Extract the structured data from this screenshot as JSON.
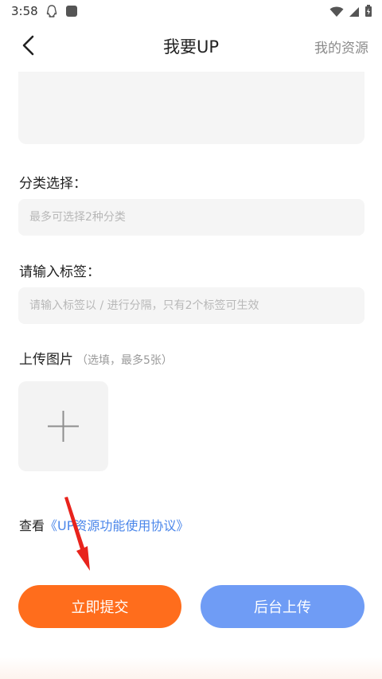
{
  "status_bar": {
    "time": "3:58"
  },
  "nav": {
    "title": "我要UP",
    "action": "我的资源"
  },
  "category": {
    "label": "分类选择：",
    "placeholder": "最多可选择2种分类"
  },
  "tags": {
    "label": "请输入标签：",
    "placeholder": "请输入标签以 / 进行分隔，只有2个标签可生效"
  },
  "images": {
    "label": "上传图片",
    "hint": "（选填，最多5张）"
  },
  "agreement": {
    "prefix": "查看",
    "link": "《UP资源功能使用协议》"
  },
  "buttons": {
    "submit": "立即提交",
    "background_upload": "后台上传"
  },
  "colors": {
    "submit": "#ff6d1c",
    "background_upload": "#6f9cf5",
    "link": "#4a86ea",
    "annotation_arrow": "#e8231c"
  }
}
